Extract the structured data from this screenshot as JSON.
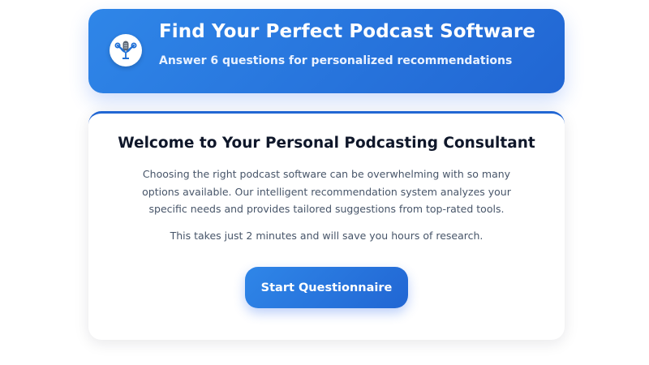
{
  "header": {
    "logo_icon": "podcast-microphone-tools-icon",
    "title": "Find Your Perfect Podcast Software",
    "subtitle": "Answer 6 questions for personalized recommendations"
  },
  "welcome": {
    "title": "Welcome to Your Personal Podcasting Consultant",
    "description": "Choosing the right podcast software can be overwhelming with so many options available. Our intelligent recommendation system analyzes your specific needs and provides tailored suggestions from top-rated tools.",
    "time_note": "This takes just 2 minutes and will save you hours of research.",
    "start_button_label": "Start Questionnaire"
  },
  "colors": {
    "accent_start": "#2f86e8",
    "accent_end": "#2166d3",
    "heading_text": "#0f172a",
    "body_text": "#475569"
  }
}
